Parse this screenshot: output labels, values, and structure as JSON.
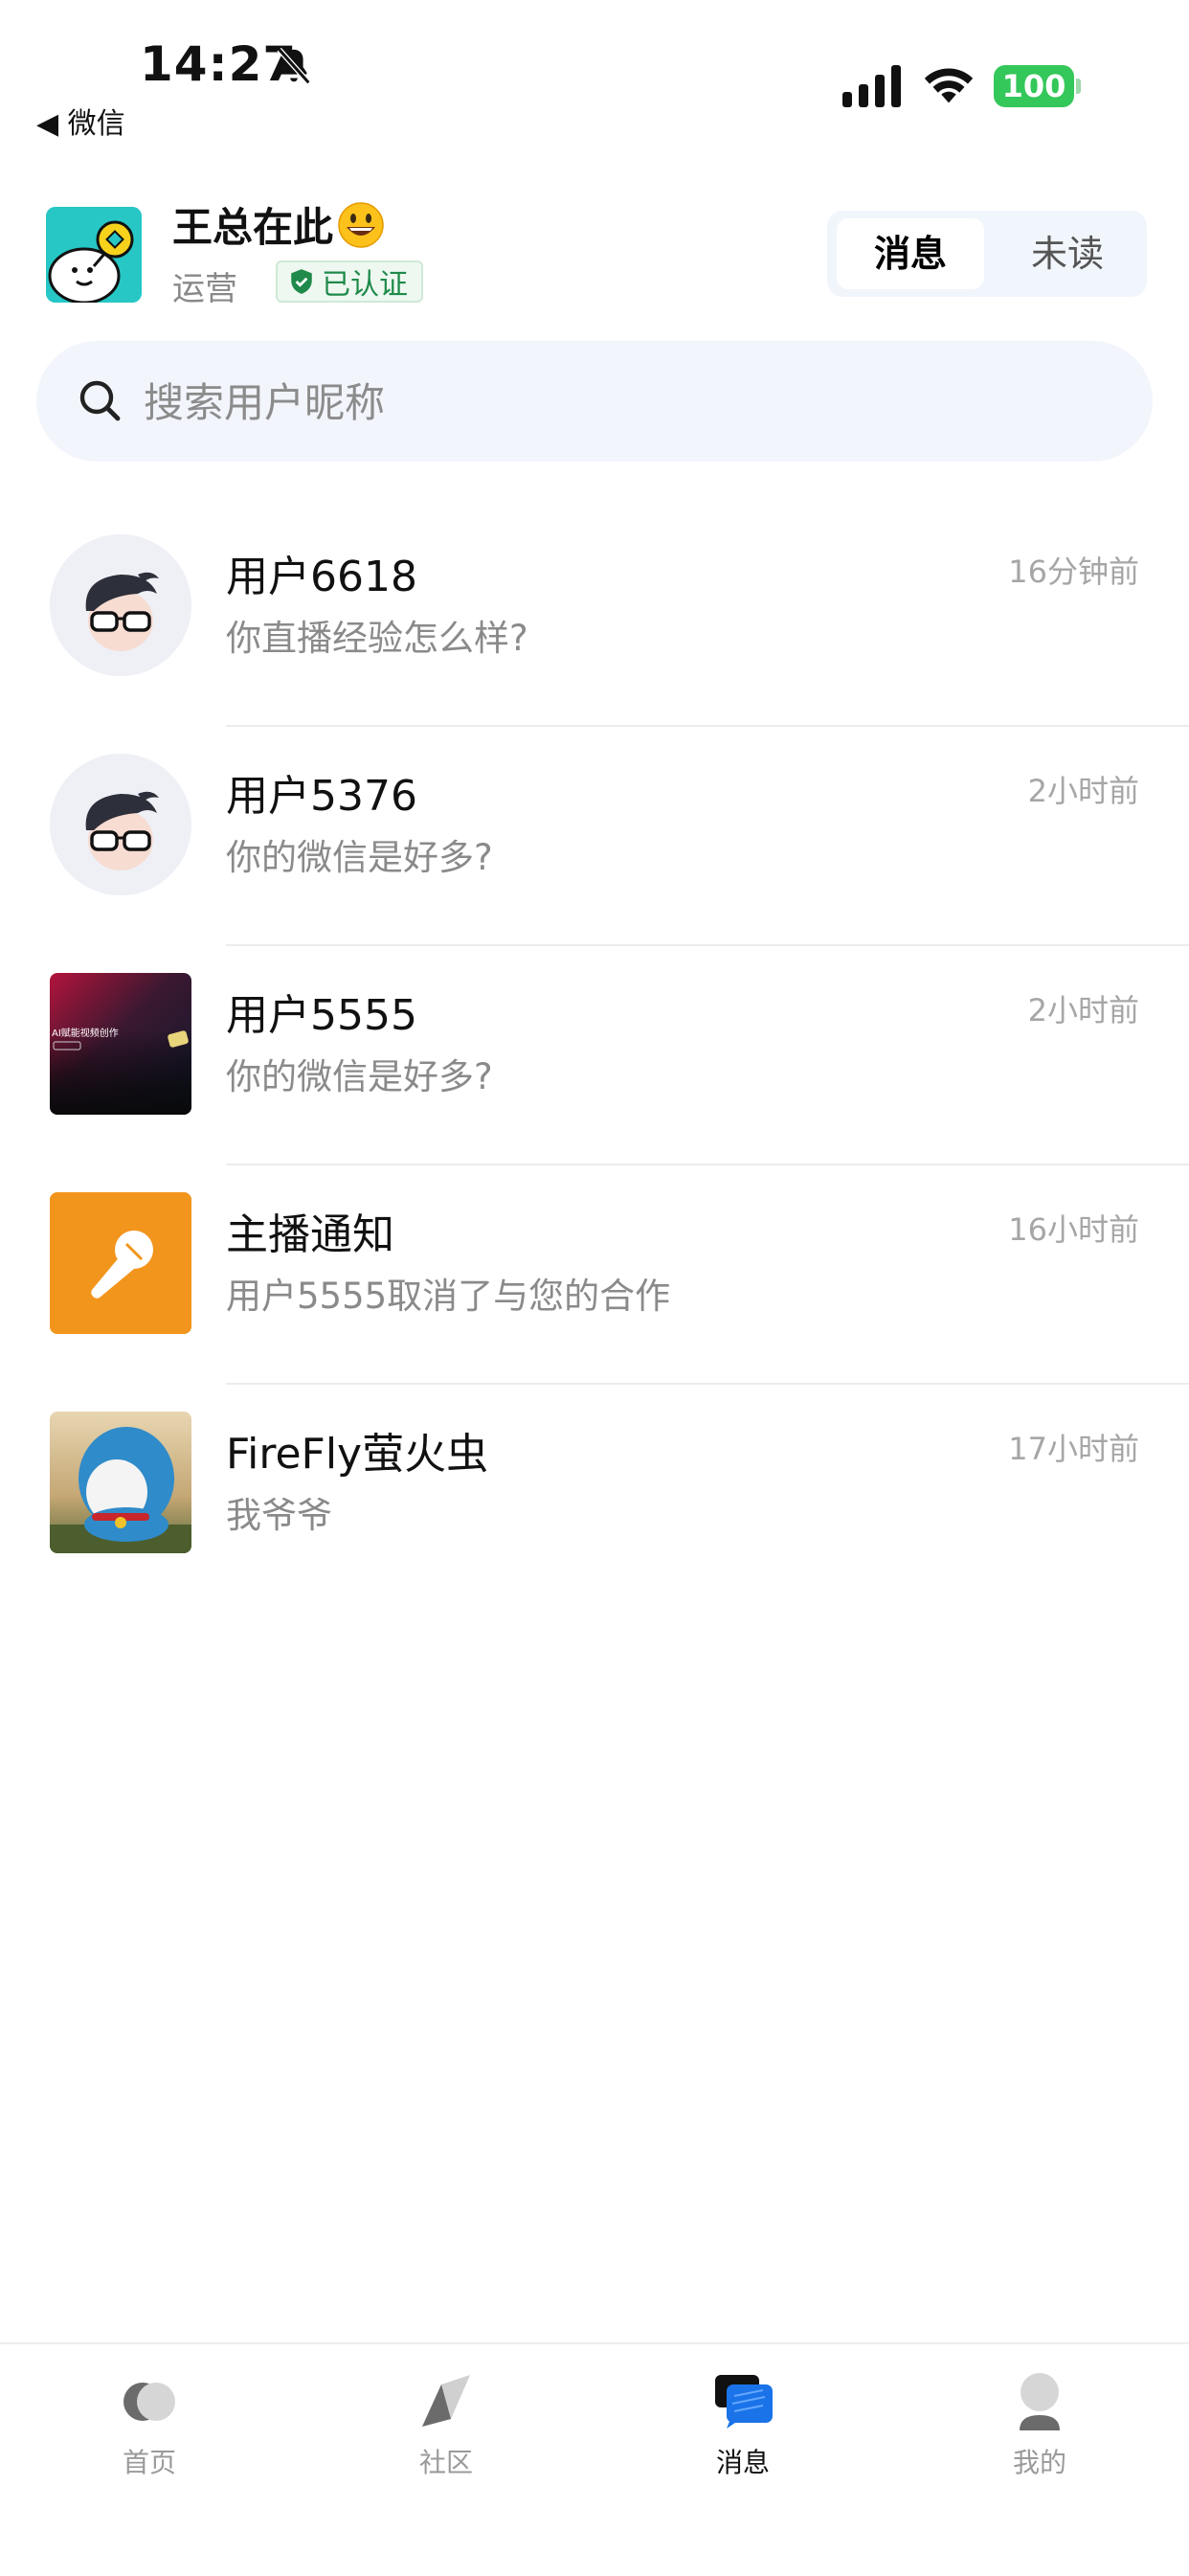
{
  "status_bar": {
    "time": "14:27",
    "back_app": "◀ 微信",
    "battery": "100",
    "battery_color": "#34c759"
  },
  "header": {
    "name": "王总在此",
    "role": "运营",
    "verified_label": "已认证",
    "segment": {
      "active": "消息",
      "inactive": "未读"
    }
  },
  "search": {
    "placeholder": "搜索用户昵称",
    "value": ""
  },
  "messages": [
    {
      "name": "用户6618",
      "time": "16分钟前",
      "preview": "你直播经验怎么样?",
      "avatar": "cartoon-glasses-icon"
    },
    {
      "name": "用户5376",
      "time": "2小时前",
      "preview": "你的微信是好多?",
      "avatar": "cartoon-glasses-icon"
    },
    {
      "name": "用户5555",
      "time": "2小时前",
      "preview": "你的微信是好多?",
      "avatar": "ai-video-thumbnail",
      "avatar_text": "AI赋能视频创作"
    },
    {
      "name": "主播通知",
      "time": "16小时前",
      "preview": "用户5555取消了与您的合作",
      "avatar": "microphone-icon"
    },
    {
      "name": "FireFly萤火虫",
      "time": "17小时前",
      "preview": "我爷爷",
      "avatar": "doraemon-photo"
    }
  ],
  "tabbar": {
    "items": [
      {
        "label": "首页",
        "icon": "home-icon"
      },
      {
        "label": "社区",
        "icon": "community-icon"
      },
      {
        "label": "消息",
        "icon": "message-icon",
        "active": true
      },
      {
        "label": "我的",
        "icon": "profile-icon"
      }
    ]
  },
  "colors": {
    "accent_blue": "#1a73e8",
    "notify_orange": "#f2951d",
    "avatar_teal": "#27c7c6",
    "verified_green": "#1f8a4a"
  }
}
